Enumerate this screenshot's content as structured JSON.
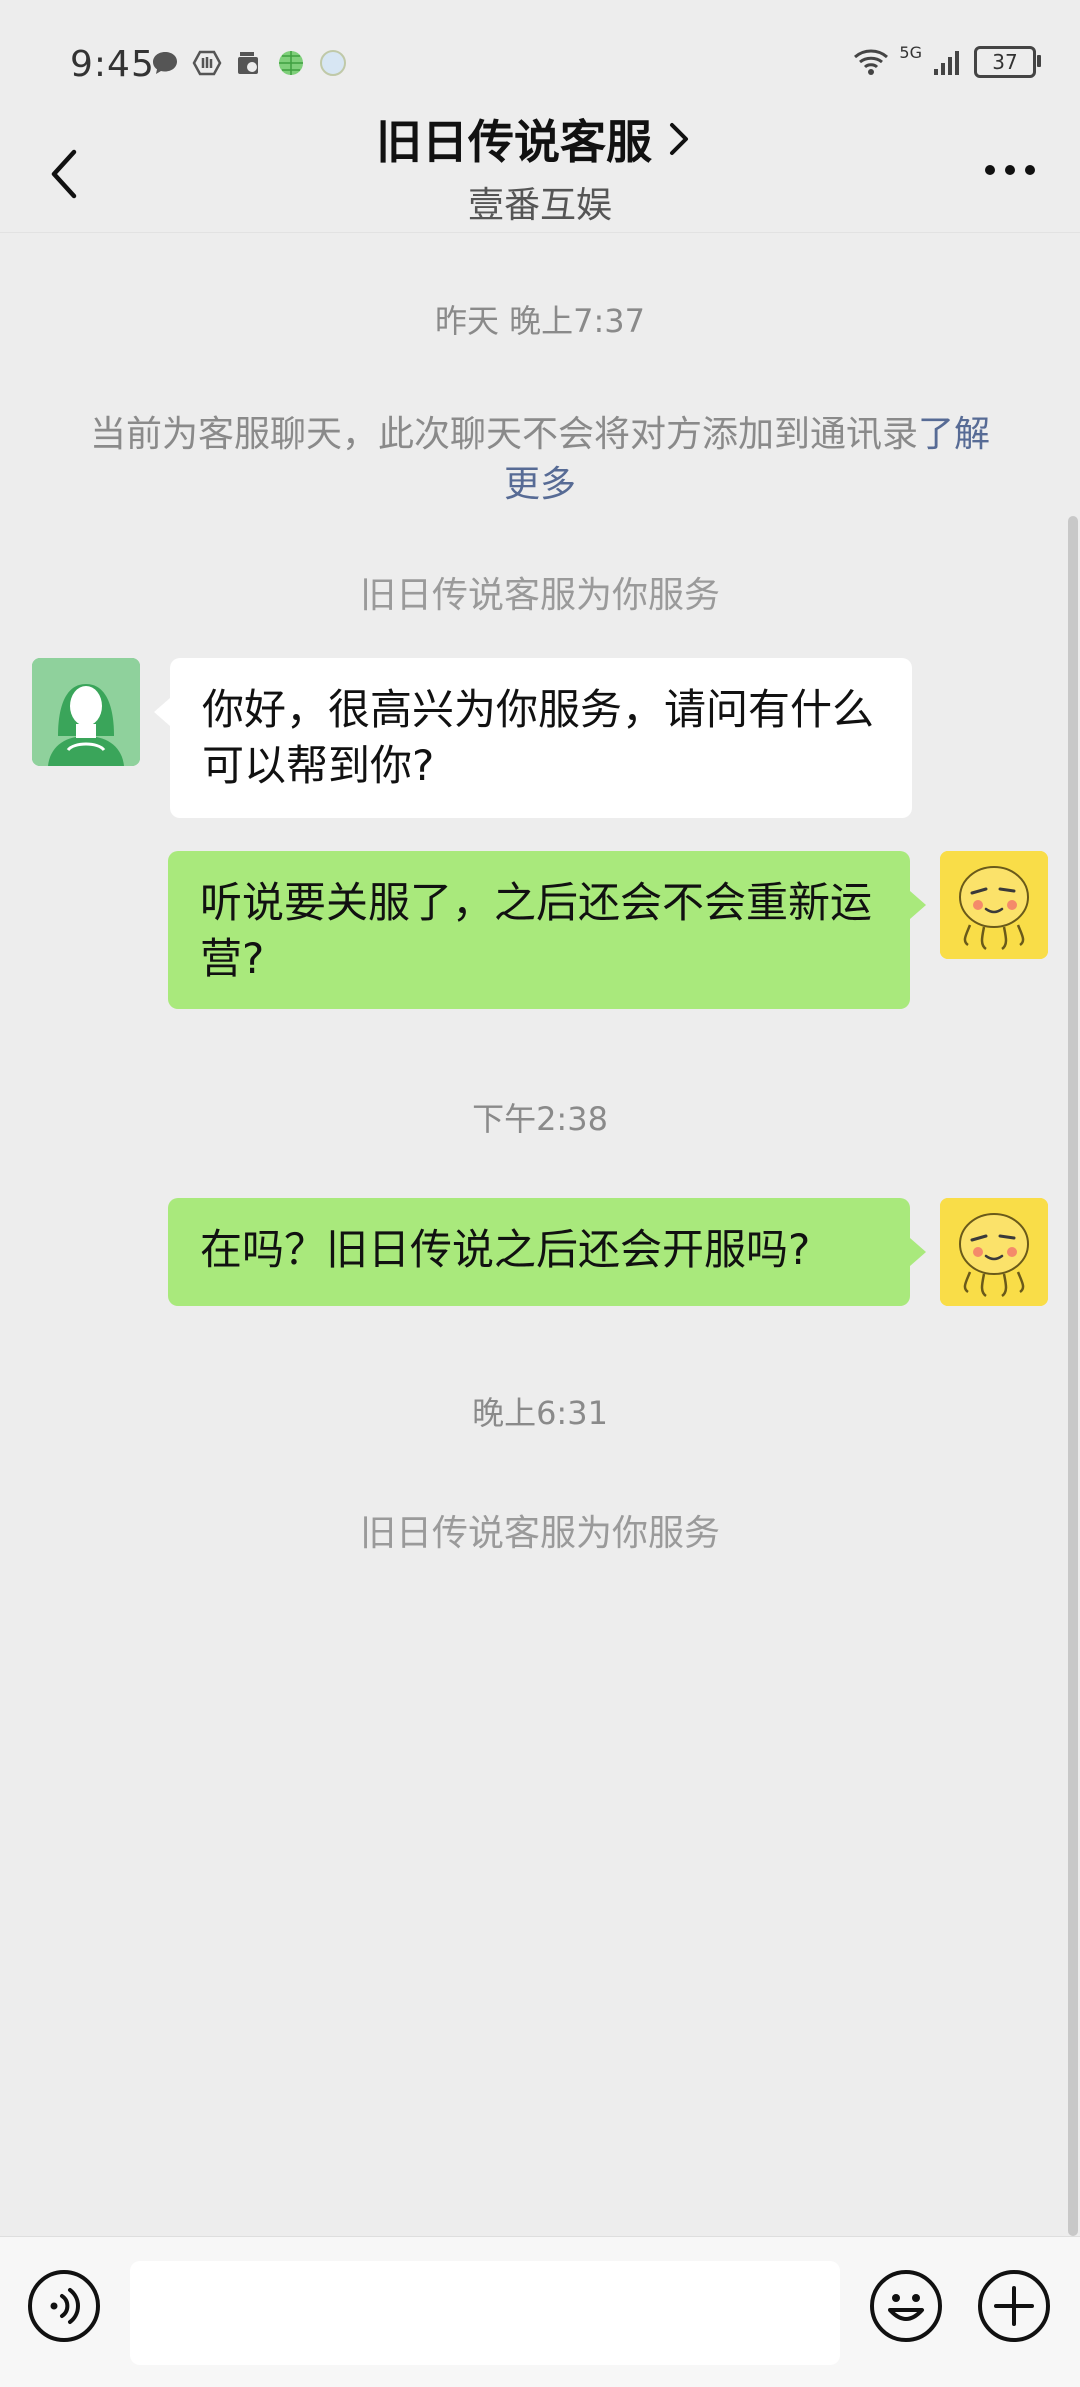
{
  "status_bar": {
    "time": "9:45",
    "network": "5G",
    "battery": "37",
    "left_icons": [
      "message-icon",
      "app-icon",
      "camera-icon",
      "globe-icon",
      "moon-icon"
    ]
  },
  "nav": {
    "title": "旧日传说客服",
    "subtitle": "壹番互娱"
  },
  "chat": {
    "timestamps": [
      "昨天 晚上7:37",
      "下午2:38",
      "晚上6:31"
    ],
    "notice_text": "当前为客服聊天，此次聊天不会将对方添加到通讯录",
    "notice_link": "了解更多",
    "service_notice": "旧日传说客服为你服务",
    "messages": [
      {
        "side": "left",
        "text": "你好，很高兴为你服务，请问有什么可以帮到你?"
      },
      {
        "side": "right",
        "text": "听说要关服了，之后还会不会重新运营?"
      },
      {
        "side": "right",
        "text": "在吗？旧日传说之后还会开服吗?"
      }
    ]
  },
  "colors": {
    "background": "#ededed",
    "self_bubble": "#a9e97c",
    "other_bubble": "#ffffff",
    "link": "#576b95"
  }
}
